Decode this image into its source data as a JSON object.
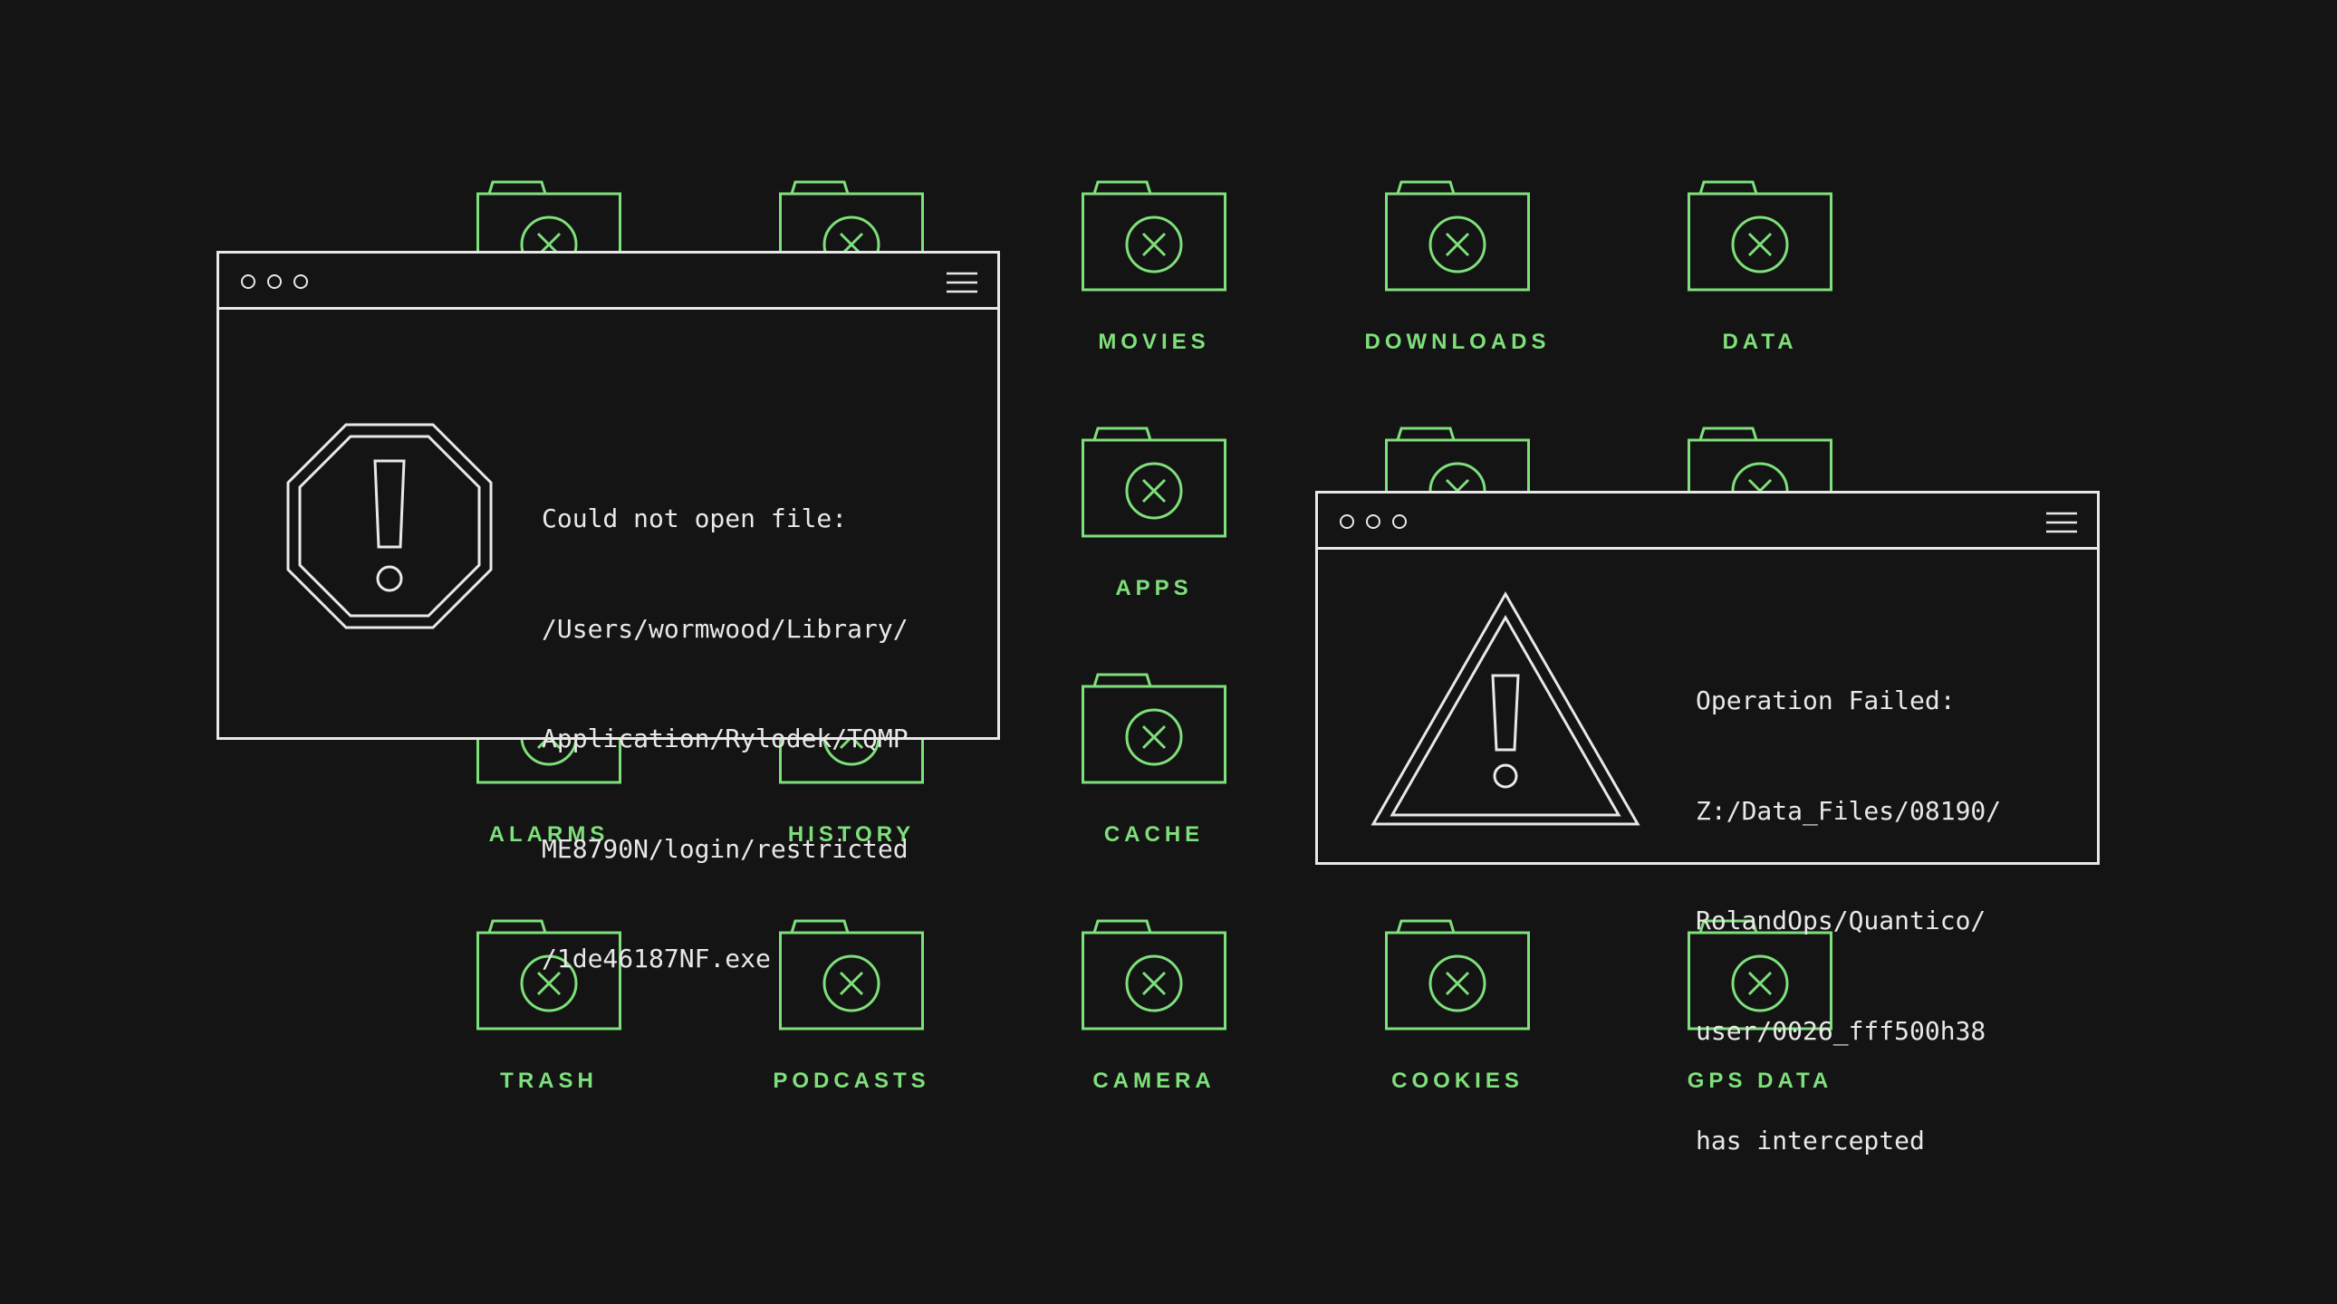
{
  "colors": {
    "background": "#141414",
    "accent": "#7ee07a",
    "window_stroke": "#e8e8e8"
  },
  "folders": [
    {
      "id": "hidden-1",
      "label": ""
    },
    {
      "id": "hidden-2",
      "label": ""
    },
    {
      "id": "movies",
      "label": "MOVIES"
    },
    {
      "id": "downloads",
      "label": "DOWNLOADS"
    },
    {
      "id": "data",
      "label": "DATA"
    },
    {
      "id": "apps",
      "label": "APPS"
    },
    {
      "id": "hidden-3",
      "label": ""
    },
    {
      "id": "hidden-4",
      "label": ""
    },
    {
      "id": "alarms",
      "label": "ALARMS"
    },
    {
      "id": "history",
      "label": "HISTORY"
    },
    {
      "id": "cache",
      "label": "CACHE"
    },
    {
      "id": "trash",
      "label": "TRASH"
    },
    {
      "id": "podcasts",
      "label": "PODCASTS"
    },
    {
      "id": "camera",
      "label": "CAMERA"
    },
    {
      "id": "cookies",
      "label": "COOKIES"
    },
    {
      "id": "gps-data",
      "label": "GPS DATA"
    }
  ],
  "error_window": {
    "icon": "octagon-exclamation-icon",
    "lines": [
      "Could not open file:",
      "/Users/wormwood/Library/",
      "Application/Rylodek/TQMP",
      "ME8790N/login/restricted",
      "/1de46187NF.exe"
    ]
  },
  "warning_window": {
    "icon": "triangle-exclamation-icon",
    "lines": [
      "Operation Failed:",
      "Z:/Data_Files/08190/",
      "RolandOps/Quantico/",
      "user/0026_fff500h38",
      "has intercepted"
    ]
  }
}
